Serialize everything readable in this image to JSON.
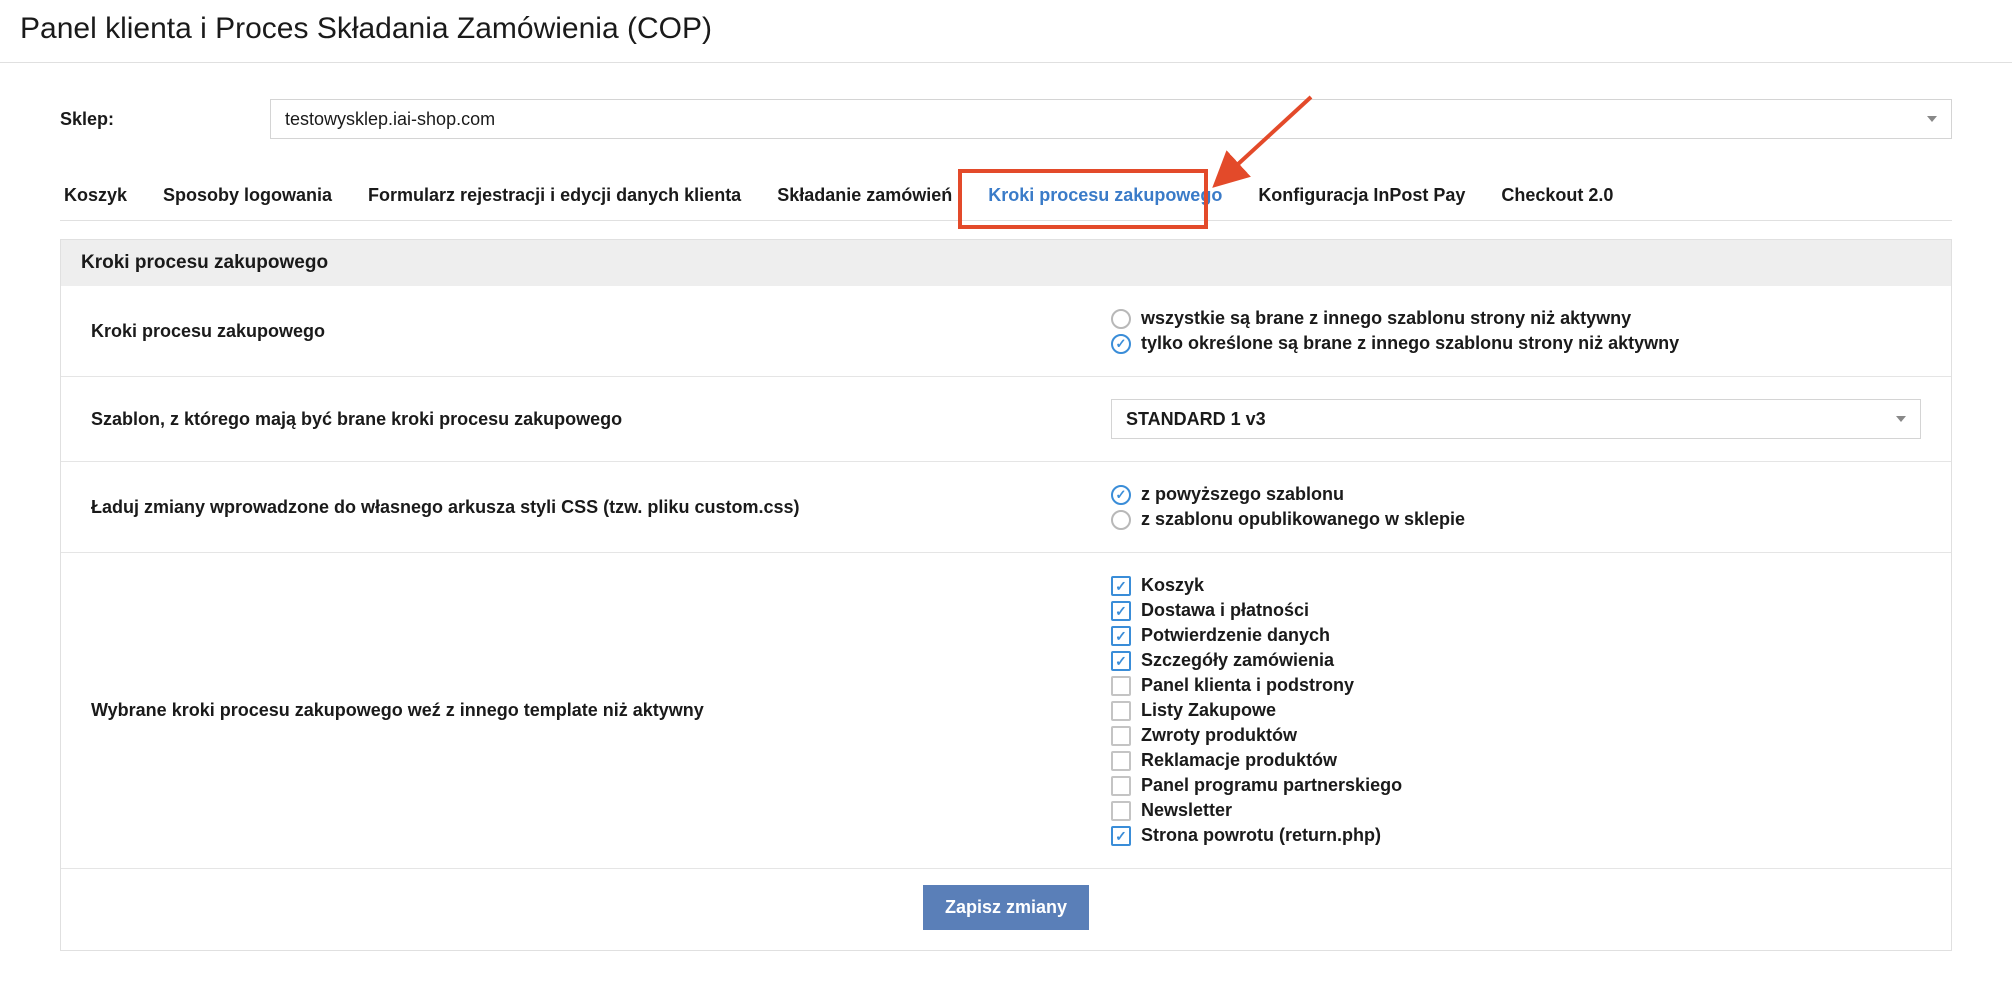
{
  "page_title": "Panel klienta i Proces Składania Zamówienia (COP)",
  "shop": {
    "label": "Sklep:",
    "selected": "testowysklep.iai-shop.com"
  },
  "tabs": [
    {
      "label": "Koszyk",
      "active": false
    },
    {
      "label": "Sposoby logowania",
      "active": false
    },
    {
      "label": "Formularz rejestracji i edycji danych klienta",
      "active": false
    },
    {
      "label": "Składanie zamówień",
      "active": false
    },
    {
      "label": "Kroki procesu zakupowego",
      "active": true
    },
    {
      "label": "Konfiguracja InPost Pay",
      "active": false
    },
    {
      "label": "Checkout 2.0",
      "active": false
    }
  ],
  "panel": {
    "header": "Kroki procesu zakupowego",
    "row_steps": {
      "label": "Kroki procesu zakupowego",
      "options": [
        {
          "label": "wszystkie są brane z innego szablonu strony niż aktywny",
          "checked": false
        },
        {
          "label": "tylko określone są brane z innego szablonu strony niż aktywny",
          "checked": true
        }
      ]
    },
    "row_template": {
      "label": "Szablon, z którego mają być brane kroki procesu zakupowego",
      "selected": "STANDARD 1 v3"
    },
    "row_css": {
      "label": "Ładuj zmiany wprowadzone do własnego arkusza styli CSS (tzw. pliku custom.css)",
      "options": [
        {
          "label": "z powyższego szablonu",
          "checked": true
        },
        {
          "label": "z szablonu opublikowanego w sklepie",
          "checked": false
        }
      ]
    },
    "row_selected_steps": {
      "label": "Wybrane kroki procesu zakupowego weź z innego template niż aktywny",
      "options": [
        {
          "label": "Koszyk",
          "checked": true
        },
        {
          "label": "Dostawa i płatności",
          "checked": true
        },
        {
          "label": "Potwierdzenie danych",
          "checked": true
        },
        {
          "label": "Szczegóły zamówienia",
          "checked": true
        },
        {
          "label": "Panel klienta i podstrony",
          "checked": false
        },
        {
          "label": "Listy Zakupowe",
          "checked": false
        },
        {
          "label": "Zwroty produktów",
          "checked": false
        },
        {
          "label": "Reklamacje produktów",
          "checked": false
        },
        {
          "label": "Panel programu partnerskiego",
          "checked": false
        },
        {
          "label": "Newsletter",
          "checked": false
        },
        {
          "label": "Strona powrotu (return.php)",
          "checked": true
        }
      ]
    },
    "save_button": "Zapisz zmiany"
  }
}
